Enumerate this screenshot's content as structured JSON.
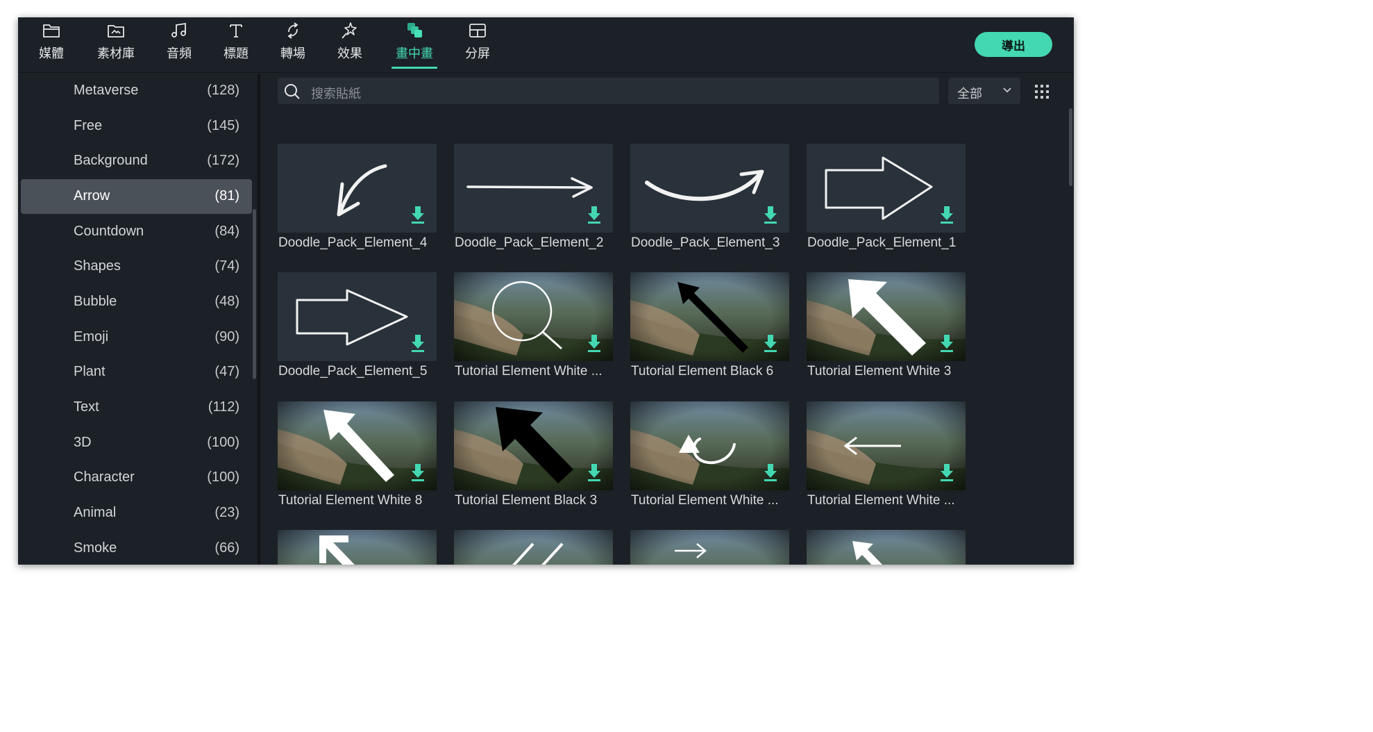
{
  "toolbar": {
    "tabs": [
      {
        "label": "媒體",
        "icon": "folder-icon"
      },
      {
        "label": "素材庫",
        "icon": "stock-library-icon"
      },
      {
        "label": "音頻",
        "icon": "music-note-icon"
      },
      {
        "label": "標題",
        "icon": "text-title-icon"
      },
      {
        "label": "轉場",
        "icon": "transition-icon"
      },
      {
        "label": "效果",
        "icon": "effects-sparkle-icon"
      },
      {
        "label": "畫中畫",
        "icon": "picture-in-picture-icon"
      },
      {
        "label": "分屏",
        "icon": "split-screen-icon"
      }
    ],
    "active_tab": "畫中畫",
    "export_label": "導出"
  },
  "sidebar": {
    "categories": [
      {
        "name": "Metaverse",
        "count": "(128)"
      },
      {
        "name": "Free",
        "count": "(145)"
      },
      {
        "name": "Background",
        "count": "(172)"
      },
      {
        "name": "Arrow",
        "count": "(81)"
      },
      {
        "name": "Countdown",
        "count": "(84)"
      },
      {
        "name": "Shapes",
        "count": "(74)"
      },
      {
        "name": "Bubble",
        "count": "(48)"
      },
      {
        "name": "Emoji",
        "count": "(90)"
      },
      {
        "name": "Plant",
        "count": "(47)"
      },
      {
        "name": "Text",
        "count": "(112)"
      },
      {
        "name": "3D",
        "count": "(100)"
      },
      {
        "name": "Character",
        "count": "(100)"
      },
      {
        "name": "Animal",
        "count": "(23)"
      },
      {
        "name": "Smoke",
        "count": "(66)"
      }
    ],
    "selected": "Arrow"
  },
  "search": {
    "placeholder": "搜索貼紙"
  },
  "filter": {
    "value": "全部"
  },
  "grid": {
    "items": [
      {
        "label": "Doodle_Pack_Element_4",
        "kind": "doodle"
      },
      {
        "label": "Doodle_Pack_Element_2",
        "kind": "doodle"
      },
      {
        "label": "Doodle_Pack_Element_3",
        "kind": "doodle"
      },
      {
        "label": "Doodle_Pack_Element_1",
        "kind": "doodle"
      },
      {
        "label": "Doodle_Pack_Element_5",
        "kind": "doodle"
      },
      {
        "label": "Tutorial Element White ...",
        "kind": "photo"
      },
      {
        "label": "Tutorial Element Black 6",
        "kind": "photo"
      },
      {
        "label": "Tutorial Element White 3",
        "kind": "photo"
      },
      {
        "label": "Tutorial Element White 8",
        "kind": "photo"
      },
      {
        "label": "Tutorial Element Black 3",
        "kind": "photo"
      },
      {
        "label": "Tutorial Element White ...",
        "kind": "photo"
      },
      {
        "label": "Tutorial Element White ...",
        "kind": "photo"
      },
      {
        "label": "",
        "kind": "photo"
      },
      {
        "label": "",
        "kind": "photo"
      },
      {
        "label": "",
        "kind": "photo"
      },
      {
        "label": "",
        "kind": "photo"
      }
    ]
  },
  "colors": {
    "accent": "#43d8b2",
    "background": "#1c2127",
    "selected_row": "#4b5158",
    "thumbnail": "#29313a"
  }
}
